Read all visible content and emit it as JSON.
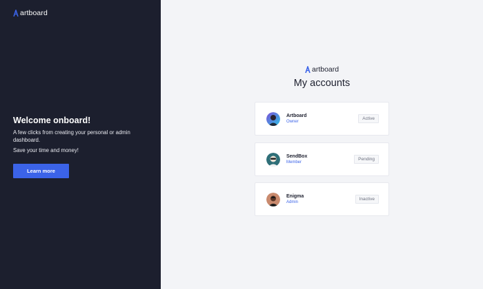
{
  "brand": {
    "name": "artboard",
    "accent": "#3b63e8"
  },
  "left_panel": {
    "heading": "Welcome onboard!",
    "description": "A few clicks from creating your personal or admin dashboard.",
    "tagline": "Save your time and money!",
    "cta_label": "Learn more"
  },
  "main": {
    "title": "My accounts",
    "accounts": [
      {
        "name": "Artboard",
        "role": "Owner",
        "status": "Active"
      },
      {
        "name": "SendBox",
        "role": "Member",
        "status": "Pending"
      },
      {
        "name": "Enigma",
        "role": "Admin",
        "status": "Inactive"
      }
    ]
  }
}
